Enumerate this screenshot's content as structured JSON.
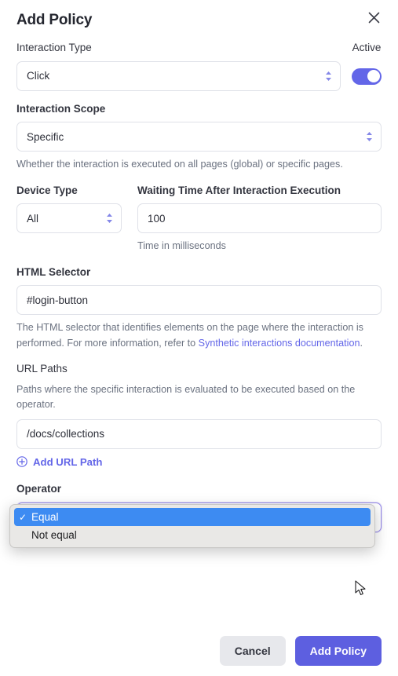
{
  "dialog": {
    "title": "Add Policy",
    "close_icon": "close-icon"
  },
  "fields": {
    "interaction_type": {
      "label": "Interaction Type",
      "value": "Click",
      "options": [
        "Click"
      ]
    },
    "active": {
      "label": "Active",
      "state": "on"
    },
    "interaction_scope": {
      "label": "Interaction Scope",
      "value": "Specific",
      "options": [
        "Specific"
      ],
      "help": "Whether the interaction is executed on all pages (global) or specific pages."
    },
    "device_type": {
      "label": "Device Type",
      "value": "All",
      "options": [
        "All"
      ]
    },
    "waiting_time": {
      "label": "Waiting Time After Interaction Execution",
      "value": "100",
      "placeholder": "100",
      "help": "Time in milliseconds"
    },
    "html_selector": {
      "label": "HTML Selector",
      "value": "#login-button",
      "placeholder": "#login-button",
      "help_part1": "The HTML selector that identifies elements on the page where the interaction is performed. For more information, refer to ",
      "help_link": "Synthetic interactions documentation",
      "help_part2": "."
    },
    "url_paths": {
      "label": "URL Paths",
      "help": "Paths where the specific interaction is evaluated to be executed based on the operator.",
      "value": "/docs/collections",
      "placeholder": "/docs/collections",
      "add_label": "Add URL Path",
      "add_icon": "plus-circle-icon"
    },
    "operator": {
      "label": "Operator",
      "value": "Equal",
      "expanded": true,
      "options": [
        {
          "label": "Equal",
          "selected": true
        },
        {
          "label": "Not equal",
          "selected": false
        }
      ]
    }
  },
  "footer": {
    "cancel_label": "Cancel",
    "submit_label": "Add Policy"
  },
  "colors": {
    "accent": "#6366e8",
    "primary_button": "#5d5fe0",
    "toggle_on": "#6366e8",
    "popup_highlight": "#3d8bf2",
    "help_text": "#6b7280",
    "border": "#dfe1e8"
  }
}
